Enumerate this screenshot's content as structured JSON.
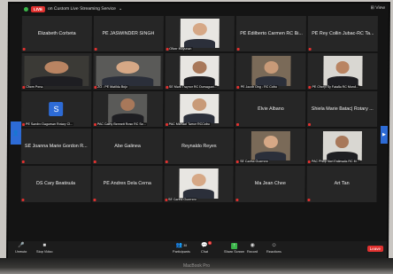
{
  "topbar": {
    "live_label": "LIVE",
    "stream_label": "on Custom Live Streaming Service",
    "view_label": "View"
  },
  "tiles": [
    {
      "name": "Elizabeth Corbeta"
    },
    {
      "name": "PE JASWINDER SINGH"
    },
    {
      "name": "Oliver Muyunan",
      "photo": true
    },
    {
      "name": "PE Edilberto Carmen RC Bi..."
    },
    {
      "name": "PE Rey Collin Jubac-RC Ta..."
    },
    {
      "name": "Chem Pena",
      "photo": true
    },
    {
      "name": "ZO - PE Matilda Bejo",
      "photo": true
    },
    {
      "name": "SE Mark Traynor RC Dumaguet...",
      "photo": true
    },
    {
      "name": "PE Jacob Ong - RC Cebu",
      "photo": true
    },
    {
      "name": "PE Cheryl Sy Fatalla RC Mund...",
      "photo": true
    },
    {
      "name": "PE Sandro Daguman Rotary Cl...",
      "avatar": "S"
    },
    {
      "name": "PAC Cathy Bennett Rose RC Se...",
      "photo": true
    },
    {
      "name": "PAC Michael Tamor RCCebu",
      "photo": true
    },
    {
      "name": "Elvie Albano"
    },
    {
      "name": "Shiela Marie Batac| Rotary ..."
    },
    {
      "name": "SE Joanna Marie Gordon R..."
    },
    {
      "name": "Abe Galinea"
    },
    {
      "name": "Reynaldo Reyes"
    },
    {
      "name": "SE Carina Guerrero",
      "photo": true
    },
    {
      "name": "PAC Philip Neri Estimada RC M...",
      "photo": true
    },
    {
      "name": "DS Cary Beatisula"
    },
    {
      "name": "PE Andres Dela Cerna"
    },
    {
      "name": "SE Carina Guerrero",
      "photo": true
    },
    {
      "name": "Ma Jean Chee"
    },
    {
      "name": "Art Tan"
    }
  ],
  "toolbar": {
    "unmute": "Unmute",
    "stop_video": "Stop Video",
    "participants": "Participants",
    "participants_count": "38",
    "chat": "Chat",
    "chat_badge": "1",
    "share": "Share Screen",
    "record": "Record",
    "reactions": "Reactions",
    "leave": "Leave"
  },
  "bezel": {
    "brand": "MacBook Pro"
  },
  "colors": {
    "leave": "#e0312f",
    "live": "#e0312f",
    "share": "#3bb54a",
    "tile": "#262626"
  }
}
